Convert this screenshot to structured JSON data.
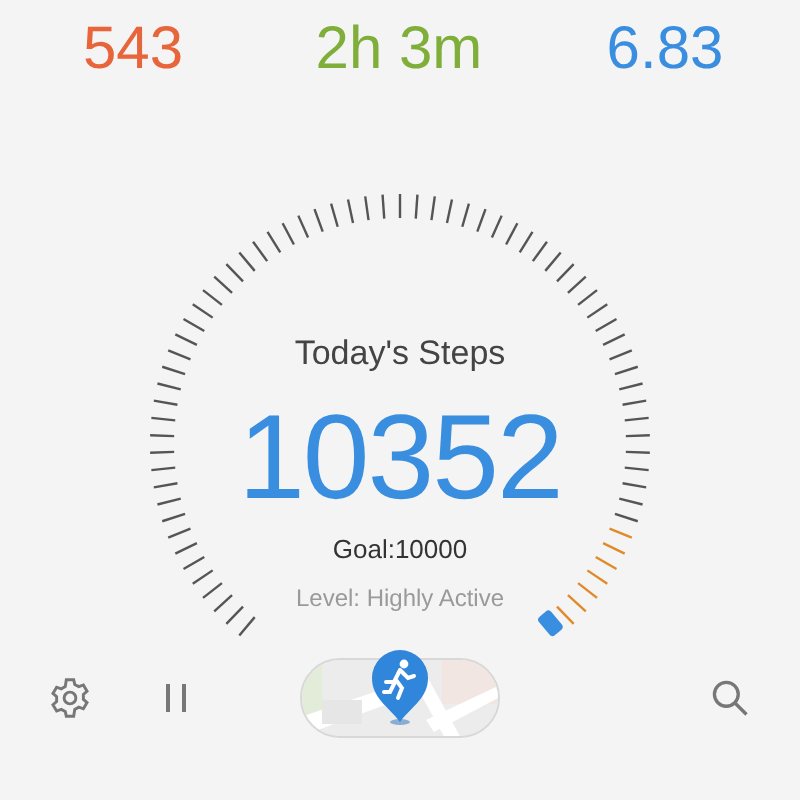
{
  "stats": [
    {
      "value": "543",
      "color": "#e8643a"
    },
    {
      "value": "2h 3m",
      "color": "#7fae3a"
    },
    {
      "value": "6.83",
      "color": "#3a8ee0"
    }
  ],
  "gauge": {
    "title": "Today's Steps",
    "steps": "10352",
    "goal": "Goal:10000",
    "activity": "Level: Highly Active"
  },
  "toolbar": {
    "paused": false
  }
}
